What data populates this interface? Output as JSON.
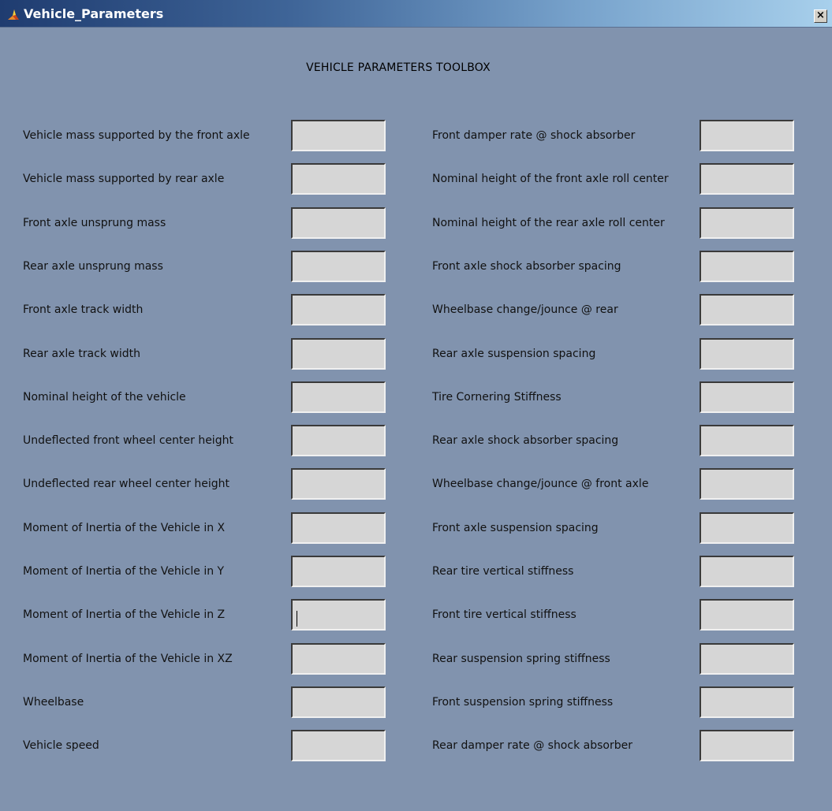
{
  "window": {
    "title": "Vehicle_Parameters",
    "close_label": "×"
  },
  "heading": "VEHICLE PARAMETERS TOOLBOX",
  "left_fields": [
    {
      "label": "Vehicle mass supported by the front axle",
      "value": ""
    },
    {
      "label": "Vehicle mass supported by rear axle",
      "value": ""
    },
    {
      "label": "Front axle unsprung mass",
      "value": ""
    },
    {
      "label": "Rear axle unsprung mass",
      "value": ""
    },
    {
      "label": "Front axle track width",
      "value": ""
    },
    {
      "label": "Rear axle track width",
      "value": ""
    },
    {
      "label": "Nominal height of the vehicle",
      "value": ""
    },
    {
      "label": "Undeflected front wheel center height",
      "value": ""
    },
    {
      "label": "Undeflected rear wheel center height",
      "value": ""
    },
    {
      "label": "Moment of Inertia of the Vehicle in X",
      "value": ""
    },
    {
      "label": "Moment of Inertia of the Vehicle in Y",
      "value": ""
    },
    {
      "label": "Moment of Inertia of the Vehicle in Z",
      "value": ""
    },
    {
      "label": "Moment of Inertia of the Vehicle in XZ",
      "value": ""
    },
    {
      "label": "Wheelbase",
      "value": ""
    },
    {
      "label": "Vehicle speed",
      "value": ""
    }
  ],
  "right_fields": [
    {
      "label": "Front damper rate @ shock absorber",
      "value": ""
    },
    {
      "label": "Nominal height of the front axle roll center",
      "value": ""
    },
    {
      "label": "Nominal height of the rear axle roll center",
      "value": ""
    },
    {
      "label": "Front axle shock absorber spacing",
      "value": ""
    },
    {
      "label": "Wheelbase change/jounce @ rear",
      "value": ""
    },
    {
      "label": "Rear axle suspension spacing",
      "value": ""
    },
    {
      "label": "Tire Cornering Stiffness",
      "value": ""
    },
    {
      "label": "Rear axle shock absorber spacing",
      "value": ""
    },
    {
      "label": "Wheelbase change/jounce @ front axle",
      "value": ""
    },
    {
      "label": "Front axle suspension spacing",
      "value": ""
    },
    {
      "label": "Rear tire vertical stiffness",
      "value": ""
    },
    {
      "label": "Front tire vertical stiffness",
      "value": ""
    },
    {
      "label": "Rear suspension spring stiffness",
      "value": ""
    },
    {
      "label": "Front suspension spring stiffness",
      "value": ""
    },
    {
      "label": "Rear damper rate @ shock absorber",
      "value": ""
    }
  ],
  "colors": {
    "background": "#8193ae",
    "field_background": "#d6d6d6",
    "title_gradient_start": "#1f3c70",
    "title_gradient_end": "#a8d0ec"
  },
  "icons": {
    "app_icon": "matlab-icon",
    "close_icon": "close-icon"
  }
}
